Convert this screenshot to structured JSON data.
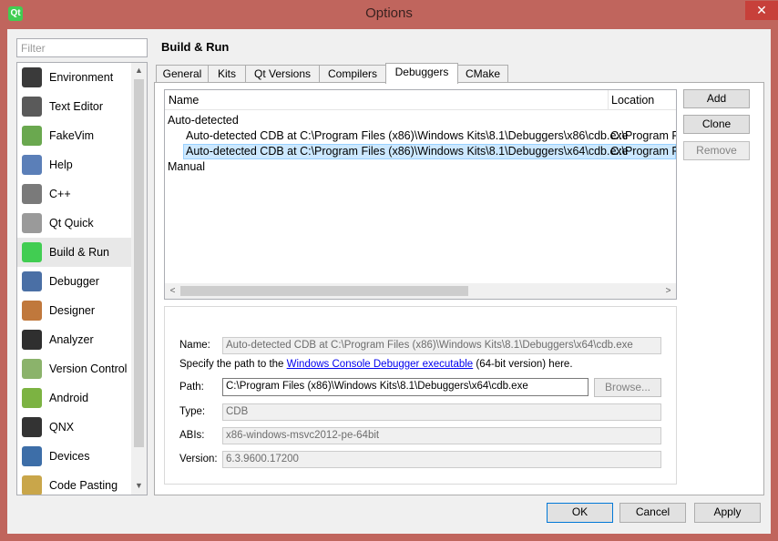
{
  "window": {
    "title": "Options",
    "app_icon_text": "Qt",
    "minimize_glyph": "–",
    "maximize_glyph": "□",
    "close_glyph": "✕"
  },
  "sidebar": {
    "filter_placeholder": "Filter",
    "items": [
      {
        "label": "Environment",
        "icon": "monitor-icon",
        "color": "#3a3a3a"
      },
      {
        "label": "Text Editor",
        "icon": "text-editor-icon",
        "color": "#5a5a5a"
      },
      {
        "label": "FakeVim",
        "icon": "fakevim-icon",
        "color": "#6aa84f"
      },
      {
        "label": "Help",
        "icon": "help-icon",
        "color": "#5b7fb8"
      },
      {
        "label": "C++",
        "icon": "cpp-braces-icon",
        "color": "#7a7a7a"
      },
      {
        "label": "Qt Quick",
        "icon": "qt-quick-icon",
        "color": "#9a9a9a"
      },
      {
        "label": "Build & Run",
        "icon": "build-run-icon",
        "color": "#41cd52"
      },
      {
        "label": "Debugger",
        "icon": "debugger-icon",
        "color": "#4a6fa5"
      },
      {
        "label": "Designer",
        "icon": "designer-icon",
        "color": "#c0783c"
      },
      {
        "label": "Analyzer",
        "icon": "analyzer-icon",
        "color": "#2f2f2f"
      },
      {
        "label": "Version Control",
        "icon": "version-control-icon",
        "color": "#8bb36b"
      },
      {
        "label": "Android",
        "icon": "android-icon",
        "color": "#7cb342"
      },
      {
        "label": "QNX",
        "icon": "qnx-icon",
        "color": "#333333"
      },
      {
        "label": "Devices",
        "icon": "devices-icon",
        "color": "#3d6ea8"
      },
      {
        "label": "Code Pasting",
        "icon": "code-pasting-icon",
        "color": "#c9a64a"
      }
    ],
    "selected_index": 6
  },
  "page": {
    "title": "Build & Run",
    "tabs": [
      "General",
      "Kits",
      "Qt Versions",
      "Compilers",
      "Debuggers",
      "CMake"
    ],
    "active_tab": "Debuggers"
  },
  "tree": {
    "columns": [
      "Name",
      "Location"
    ],
    "rows": [
      {
        "name": "Auto-detected",
        "location": "",
        "level": 0
      },
      {
        "name": "Auto-detected CDB at C:\\Program Files (x86)\\Windows Kits\\8.1\\Debuggers\\x86\\cdb.exe",
        "location": "C:\\Program F",
        "level": 1
      },
      {
        "name": "Auto-detected CDB at C:\\Program Files (x86)\\Windows Kits\\8.1\\Debuggers\\x64\\cdb.exe",
        "location": "C:\\Program F",
        "level": 1,
        "selected": true
      },
      {
        "name": "Manual",
        "location": "",
        "level": 0
      }
    ]
  },
  "side_buttons": {
    "add": "Add",
    "clone": "Clone",
    "remove": "Remove"
  },
  "details": {
    "name_label": "Name:",
    "name_value": "Auto-detected CDB at C:\\Program Files (x86)\\Windows Kits\\8.1\\Debuggers\\x64\\cdb.exe",
    "hint_prefix": "Specify the path to the ",
    "hint_link": "Windows Console Debugger executable",
    "hint_suffix": " (64-bit version) here.",
    "path_label": "Path:",
    "path_value": "C:\\Program Files (x86)\\Windows Kits\\8.1\\Debuggers\\x64\\cdb.exe",
    "browse_label": "Browse...",
    "type_label": "Type:",
    "type_value": "CDB",
    "abis_label": "ABIs:",
    "abis_value": "x86-windows-msvc2012-pe-64bit",
    "version_label": "Version:",
    "version_value": "6.3.9600.17200"
  },
  "dialog_buttons": {
    "ok": "OK",
    "cancel": "Cancel",
    "apply": "Apply"
  },
  "scroll_glyphs": {
    "up": "▲",
    "down": "▼",
    "left": "<",
    "right": ">"
  }
}
